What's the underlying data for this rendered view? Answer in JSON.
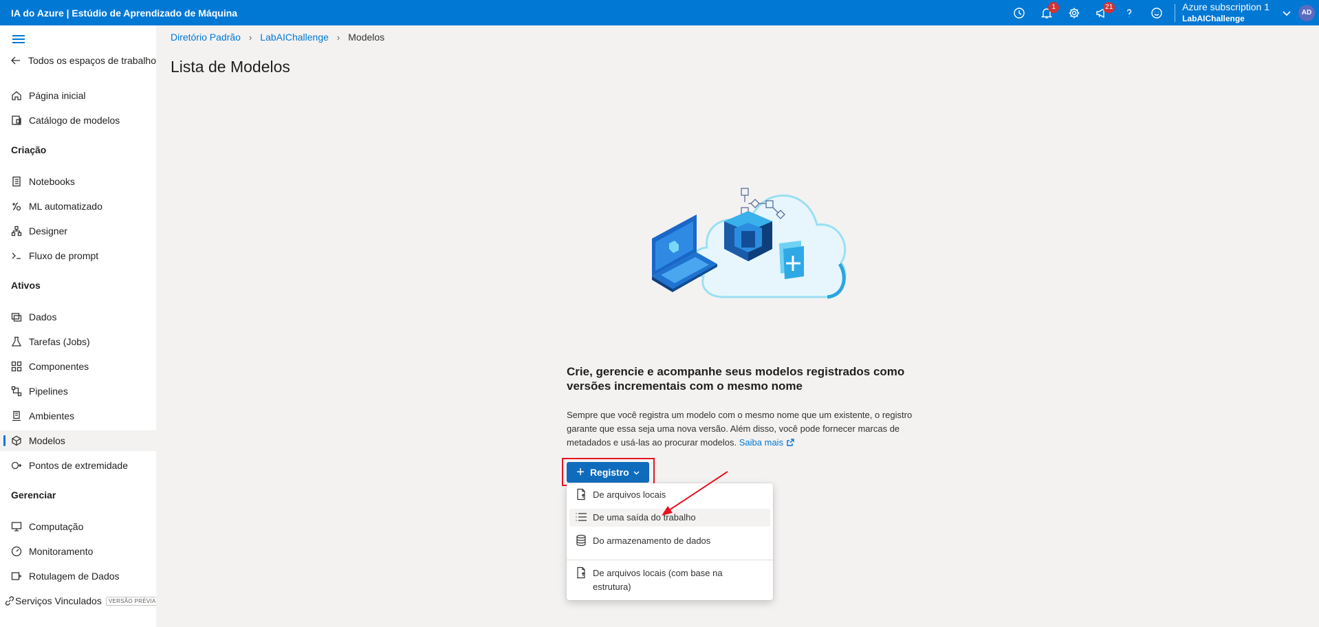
{
  "header": {
    "app_title": "IA do Azure | Estúdio de Aprendizado de Máquina",
    "notifications_count": "1",
    "announcements_count": "21",
    "subscription_name": "Azure subscription 1",
    "workspace_name": "LabAIChallenge",
    "avatar_initials": "AD"
  },
  "sidebar": {
    "back_label": "Todos os espaços de trabalho",
    "items_top": [
      {
        "label": "Página inicial",
        "icon": "home-icon"
      },
      {
        "label": "Catálogo de modelos",
        "icon": "catalog-icon"
      }
    ],
    "section_creation": "Criação",
    "items_creation": [
      {
        "label": "Notebooks",
        "icon": "notebook-icon"
      },
      {
        "label": "ML automatizado",
        "icon": "automl-icon"
      },
      {
        "label": "Designer",
        "icon": "designer-icon"
      },
      {
        "label": "Fluxo de prompt",
        "icon": "prompt-flow-icon"
      }
    ],
    "section_assets": "Ativos",
    "items_assets": [
      {
        "label": "Dados",
        "icon": "data-icon"
      },
      {
        "label": "Tarefas (Jobs)",
        "icon": "jobs-icon"
      },
      {
        "label": "Componentes",
        "icon": "components-icon"
      },
      {
        "label": "Pipelines",
        "icon": "pipelines-icon"
      },
      {
        "label": "Ambientes",
        "icon": "environments-icon"
      },
      {
        "label": "Modelos",
        "icon": "models-icon"
      },
      {
        "label": "Pontos de extremidade",
        "icon": "endpoints-icon"
      }
    ],
    "section_manage": "Gerenciar",
    "items_manage": [
      {
        "label": "Computação",
        "icon": "compute-icon"
      },
      {
        "label": "Monitoramento",
        "icon": "monitoring-icon"
      },
      {
        "label": "Rotulagem de Dados",
        "icon": "labeling-icon"
      },
      {
        "label": "Serviços Vinculados",
        "icon": "linked-services-icon"
      }
    ],
    "preview_badge": "VERSÃO PRÉVIA",
    "active_item": "Modelos"
  },
  "breadcrumb": {
    "items": [
      "Diretório Padrão",
      "LabAIChallenge",
      "Modelos"
    ]
  },
  "page": {
    "title": "Lista de Modelos",
    "empty_heading": "Crie, gerencie e acompanhe seus modelos registrados como versões incrementais com o mesmo nome",
    "empty_description": "Sempre que você registra um modelo com o mesmo nome que um existente, o registro garante que essa seja uma nova versão. Além disso, você pode fornecer marcas de metadados e usá-las ao procurar modelos.",
    "learn_more": "Saiba mais",
    "register_button": "Registro"
  },
  "register_menu": {
    "items": [
      {
        "label": "De arquivos locais",
        "icon": "file-upload-icon"
      },
      {
        "label": "De uma saída do trabalho",
        "icon": "list-icon"
      },
      {
        "label": "Do armazenamento de dados",
        "icon": "database-icon"
      },
      {
        "label": "De arquivos locais (com base na estrutura)",
        "icon": "file-upload-icon"
      }
    ],
    "hovered_item": "De uma saída do trabalho"
  },
  "colors": {
    "brand": "#0078d4",
    "highlight_box": "#e81123",
    "badge": "#d13438"
  }
}
